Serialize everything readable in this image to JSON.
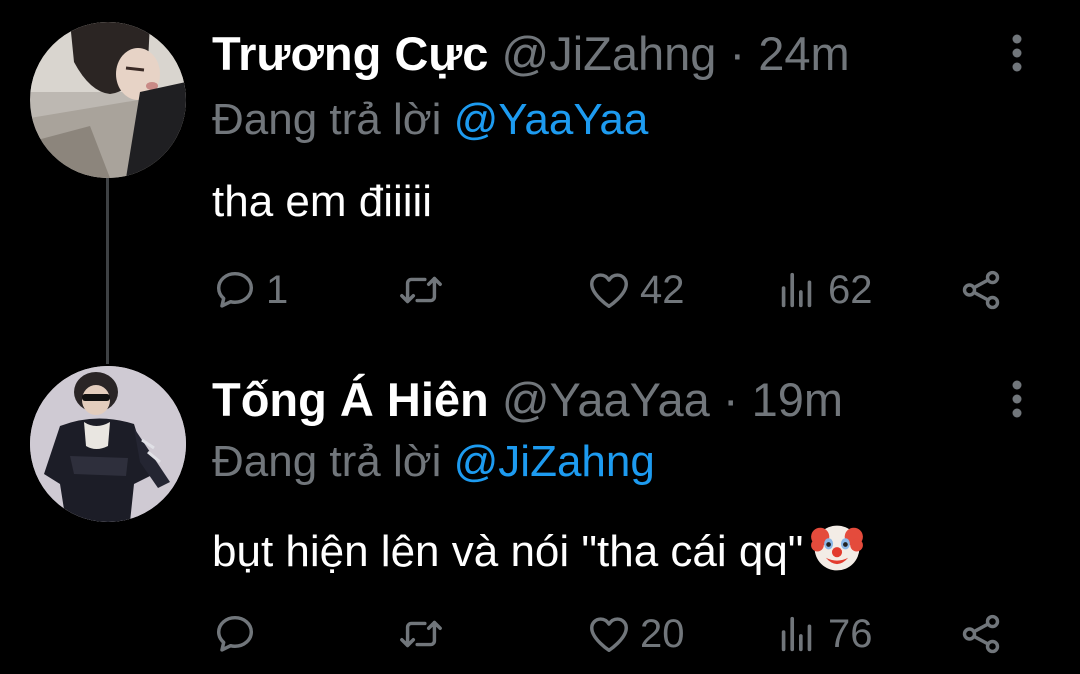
{
  "tweets": [
    {
      "display_name": "Trương Cực",
      "handle": "@JiZahng",
      "separator": "·",
      "time": "24m",
      "reply_prefix": "Đang trả lời",
      "reply_to": "@YaaYaa",
      "text": "tha em điiiii",
      "avatar": "avatar-photo",
      "actions": {
        "reply": {
          "icon": "reply-icon",
          "count": "1"
        },
        "retweet": {
          "icon": "retweet-icon",
          "count": ""
        },
        "like": {
          "icon": "heart-icon",
          "count": "42"
        },
        "views": {
          "icon": "views-icon",
          "count": "62"
        },
        "share": {
          "icon": "share-icon"
        }
      },
      "menu_icon": "more-vertical-icon"
    },
    {
      "display_name": "Tống Á Hiên",
      "handle": "@YaaYaa",
      "separator": "·",
      "time": "19m",
      "reply_prefix": "Đang trả lời",
      "reply_to": "@JiZahng",
      "text": "bụt hiện lên và nói \"tha cái qq\"",
      "emoji": "clown-face-emoji",
      "avatar": "avatar-photo",
      "actions": {
        "reply": {
          "icon": "reply-icon",
          "count": ""
        },
        "retweet": {
          "icon": "retweet-icon",
          "count": ""
        },
        "like": {
          "icon": "heart-icon",
          "count": "20"
        },
        "views": {
          "icon": "views-icon",
          "count": "76"
        },
        "share": {
          "icon": "share-icon"
        }
      },
      "menu_icon": "more-vertical-icon"
    }
  ],
  "colors": {
    "background": "#000000",
    "text_primary": "#ffffff",
    "text_secondary": "#71767b",
    "mention": "#1d9bf0",
    "thread_line": "#3e4144"
  }
}
